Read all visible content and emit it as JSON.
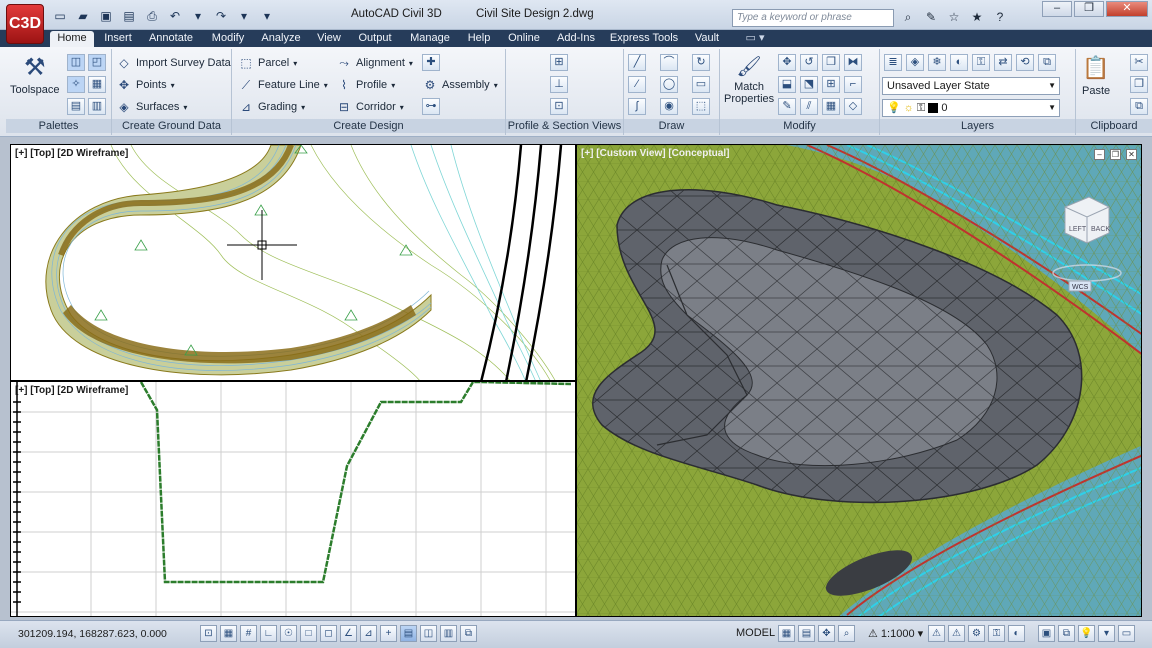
{
  "app": {
    "product": "AutoCAD Civil 3D",
    "document": "Civil Site Design 2.dwg",
    "app_button_label": "C3D",
    "search_placeholder": "Type a keyword or phrase"
  },
  "tabs": [
    "Home",
    "Insert",
    "Annotate",
    "Modify",
    "Analyze",
    "View",
    "Output",
    "Manage",
    "Help",
    "Online",
    "Add-Ins",
    "Express Tools",
    "Vault"
  ],
  "active_tab": "Home",
  "ribbon": {
    "palettes": {
      "label": "Palettes",
      "toolspace": "Toolspace"
    },
    "create_ground_data": {
      "label": "Create Ground Data",
      "import_survey": "Import Survey Data",
      "points": "Points",
      "surfaces": "Surfaces"
    },
    "create_design": {
      "label": "Create Design",
      "parcel": "Parcel",
      "feature_line": "Feature Line",
      "grading": "Grading",
      "alignment": "Alignment",
      "profile": "Profile",
      "corridor": "Corridor",
      "assembly": "Assembly"
    },
    "profile_section": {
      "label": "Profile & Section Views"
    },
    "draw": {
      "label": "Draw"
    },
    "modify": {
      "label": "Modify",
      "match_properties_1": "Match",
      "match_properties_2": "Properties"
    },
    "layers": {
      "label": "Layers",
      "layer_state": "Unsaved Layer State",
      "current_layer": "0"
    },
    "clipboard": {
      "label": "Clipboard",
      "paste": "Paste"
    }
  },
  "viewports": {
    "top_left": {
      "label": "[+] [Top] [2D Wireframe]"
    },
    "bottom_left": {
      "label": "[+] [Top] [2D Wireframe]"
    },
    "right": {
      "label": "[+] [Custom View] [Conceptual]",
      "viewcube_face": "LEFT",
      "viewcube_right": "BACK",
      "viewcube_compass": "WCS"
    }
  },
  "status": {
    "coordinates": "301209.194, 168287.623, 0.000",
    "model_label": "MODEL",
    "annotation_scale": "1:1000"
  },
  "colors": {
    "ribbon_tab_bar": "#263c5a",
    "accent_blue": "#2b4a7a",
    "terrain_green": "#8ca63a",
    "pond_gray": "#5f636b",
    "profile_green": "#2c7d2c"
  }
}
